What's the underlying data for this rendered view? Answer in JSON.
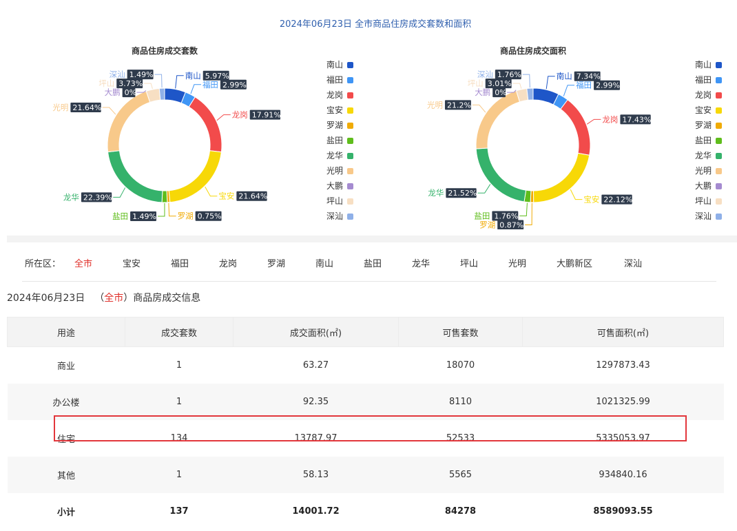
{
  "page": {
    "title": "2024年06月23日 全市商品住房成交套数和面积"
  },
  "chart_data": [
    {
      "type": "pie",
      "title": "商品住房成交套数",
      "series": [
        {
          "label": "南山",
          "value": 5.97,
          "display": "5.97%",
          "color": "#1e56c8"
        },
        {
          "label": "福田",
          "value": 2.99,
          "display": "2.99%",
          "color": "#3f95f5"
        },
        {
          "label": "龙岗",
          "value": 17.91,
          "display": "17.91%",
          "color": "#f24b4b"
        },
        {
          "label": "宝安",
          "value": 21.64,
          "display": "21.64%",
          "color": "#f7d807"
        },
        {
          "label": "罗湖",
          "value": 0.75,
          "display": "0.75%",
          "color": "#f0ab05"
        },
        {
          "label": "盐田",
          "value": 1.49,
          "display": "1.49%",
          "color": "#5fbd1c"
        },
        {
          "label": "龙华",
          "value": 22.39,
          "display": "22.39%",
          "color": "#35b26b"
        },
        {
          "label": "光明",
          "value": 21.64,
          "display": "21.64%",
          "color": "#f8c98a"
        },
        {
          "label": "大鹏",
          "value": 0,
          "display": "0%",
          "color": "#a58bd0"
        },
        {
          "label": "坪山",
          "value": 3.73,
          "display": "3.73%",
          "color": "#f7dfc3"
        },
        {
          "label": "深汕",
          "value": 1.49,
          "display": "1.49%",
          "color": "#8fb0e8"
        }
      ]
    },
    {
      "type": "pie",
      "title": "商品住房成交面积",
      "series": [
        {
          "label": "南山",
          "value": 7.34,
          "display": "7.34%",
          "color": "#1e56c8"
        },
        {
          "label": "福田",
          "value": 2.99,
          "display": "2.99%",
          "color": "#3f95f5"
        },
        {
          "label": "龙岗",
          "value": 17.43,
          "display": "17.43%",
          "color": "#f24b4b"
        },
        {
          "label": "宝安",
          "value": 22.12,
          "display": "22.12%",
          "color": "#f7d807"
        },
        {
          "label": "罗湖",
          "value": 0.87,
          "display": "0.87%",
          "color": "#f0ab05"
        },
        {
          "label": "盐田",
          "value": 1.76,
          "display": "1.76%",
          "color": "#5fbd1c"
        },
        {
          "label": "龙华",
          "value": 21.52,
          "display": "21.52%",
          "color": "#35b26b"
        },
        {
          "label": "光明",
          "value": 21.2,
          "display": "21.2%",
          "color": "#f8c98a"
        },
        {
          "label": "大鹏",
          "value": 0,
          "display": "0%",
          "color": "#a58bd0"
        },
        {
          "label": "坪山",
          "value": 3.01,
          "display": "3.01%",
          "color": "#f7dfc3"
        },
        {
          "label": "深汕",
          "value": 1.76,
          "display": "1.76%",
          "color": "#8fb0e8"
        }
      ]
    }
  ],
  "district_filter": {
    "label": "所在区：",
    "options": [
      "全市",
      "宝安",
      "福田",
      "龙岗",
      "罗湖",
      "南山",
      "盐田",
      "龙华",
      "坪山",
      "光明",
      "大鹏新区",
      "深汕"
    ],
    "selected": "全市",
    "selected_color": "#e0302a"
  },
  "info": {
    "date": "2024年06月23日",
    "open_paren": "（",
    "district": "全市",
    "close_paren": "）",
    "suffix": "商品房成交信息"
  },
  "table": {
    "headers": [
      "用途",
      "成交套数",
      "成交面积(㎡)",
      "可售套数",
      "可售面积(㎡)"
    ],
    "rows": [
      [
        "商业",
        "1",
        "63.27",
        "18070",
        "1297873.43"
      ],
      [
        "办公楼",
        "1",
        "92.35",
        "8110",
        "1021325.99"
      ],
      [
        "住宅",
        "134",
        "13787.97",
        "52533",
        "5335053.97"
      ],
      [
        "其他",
        "1",
        "58.13",
        "5565",
        "934840.16"
      ],
      [
        "小计",
        "137",
        "14001.72",
        "84278",
        "8589093.55"
      ]
    ],
    "highlighted_row": "住宅",
    "highlight_color": "#e2363b"
  }
}
